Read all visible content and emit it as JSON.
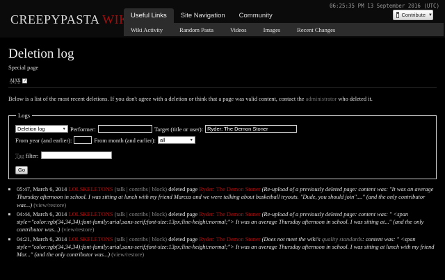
{
  "header": {
    "logo_main": "CREEPYPASTA",
    "logo_accent": "WIKI",
    "timestamp": "06:25:35 PM 13 September 2016 (UTC)",
    "contribute_label": "Contribute",
    "tabs": [
      {
        "label": "Useful Links",
        "active": true
      },
      {
        "label": "Site Navigation",
        "active": false
      },
      {
        "label": "Community",
        "active": false
      }
    ],
    "subnav": [
      "Wiki Activity",
      "Random Pasta",
      "Videos",
      "Images",
      "Recent Changes"
    ]
  },
  "page": {
    "title": "Deletion log",
    "subtitle": "Special page",
    "ajax_label": "AJAX",
    "ajax_checked": true,
    "intro_before": "Below is a list of the most recent deletions. If you don't agree with a deletion or think that a page was valid content, contact the ",
    "intro_link": "administrator",
    "intro_after": " who deleted it."
  },
  "logs_form": {
    "legend": "Logs",
    "log_type": "Deletion log",
    "performer_label": "Performer:",
    "performer_value": "",
    "target_label": "Target (title or user):",
    "target_value": "Ryder: The Demon Stoner",
    "year_label": "From year (and earlier):",
    "year_value": "",
    "month_label": "From month (and earlier):",
    "month_value": "all",
    "tag_label": "Tag",
    "tag_suffix": " filter:",
    "tag_value": "",
    "go_label": "Go"
  },
  "entries": [
    {
      "time": "05:47, March 6, 2014",
      "user": "LOLSKELETONS",
      "talk": "talk",
      "contribs": "contribs",
      "block": "block",
      "action": " deleted page ",
      "target": "Ryder: The Demon Stoner",
      "reason": "(Re-upload of a previously deleted page: content was: \"It was an average Thursday afternoon in school. I was sitting at lunch with my friend Marcus and we were talking about basketball tryouts. \"Dude, you should join\"....\" (and the only contributor was...)",
      "view_restore": "view/restore"
    },
    {
      "time": "04:44, March 6, 2014",
      "user": "LOLSKELETONS",
      "talk": "talk",
      "contribs": "contribs",
      "block": "block",
      "action": " deleted page ",
      "target": "Ryder: The Demon Stoner",
      "reason": "(Re-upload of a previously deleted page: content was: \" <span style=\"color:rgb(34,34,34);font-family:arial,sans-serif;font-size:13px;line-height:normal;\"> It was an average Thursday afternoon in school. I was sitting at...\" (and the only contributor was...)",
      "view_restore": "view/restore"
    },
    {
      "time": "04:21, March 6, 2014",
      "user": "LOLSKELETONS",
      "talk": "talk",
      "contribs": "contribs",
      "block": "block",
      "action": " deleted page ",
      "target": "Ryder: The Demon Stoner",
      "reason_before": "(Does not meet the wiki's ",
      "reason_link": "quality standards",
      "reason": ": content was: \" <span style=\"color:rgb(34,34,34);font-family:arial,sans-serif;font-size:13px;line-height:normal;\"> It was an average Thursday afternoon in school. I was sitting at lunch with my friend Mar...\" (and the only contributor was...)",
      "view_restore": "view/restore"
    }
  ]
}
